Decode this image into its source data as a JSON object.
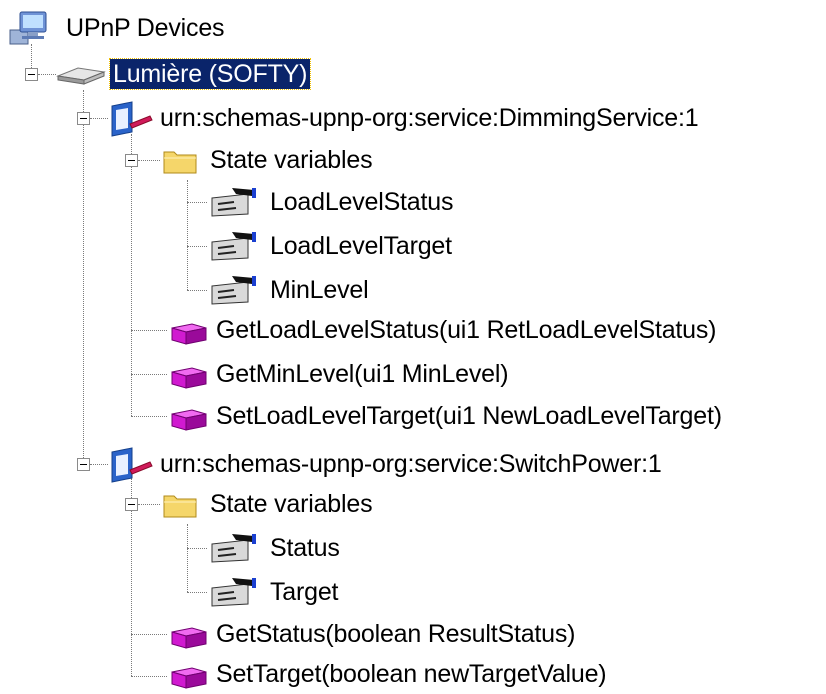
{
  "tree": {
    "root": {
      "label": "UPnP Devices",
      "icon": "upnp-devices-icon"
    },
    "device": {
      "label": "Lumière (SOFTY)",
      "icon": "device-icon",
      "selected": true
    },
    "services": [
      {
        "label": "urn:schemas-upnp-org:service:DimmingService:1",
        "icon": "service-icon",
        "state_folder": "State variables",
        "state_variables": [
          "LoadLevelStatus",
          "LoadLevelTarget",
          "MinLevel"
        ],
        "actions": [
          "GetLoadLevelStatus(ui1 RetLoadLevelStatus)",
          "GetMinLevel(ui1 MinLevel)",
          "SetLoadLevelTarget(ui1 NewLoadLevelTarget)"
        ]
      },
      {
        "label": "urn:schemas-upnp-org:service:SwitchPower:1",
        "icon": "service-icon",
        "state_folder": "State variables",
        "state_variables": [
          "Status",
          "Target"
        ],
        "actions": [
          "GetStatus(boolean ResultStatus)",
          "SetTarget(boolean newTargetValue)"
        ]
      }
    ]
  },
  "colors": {
    "selection": "#0a246a",
    "action": "#d01ad0",
    "folder": "#f5d66a",
    "service": "#2a63c9"
  }
}
